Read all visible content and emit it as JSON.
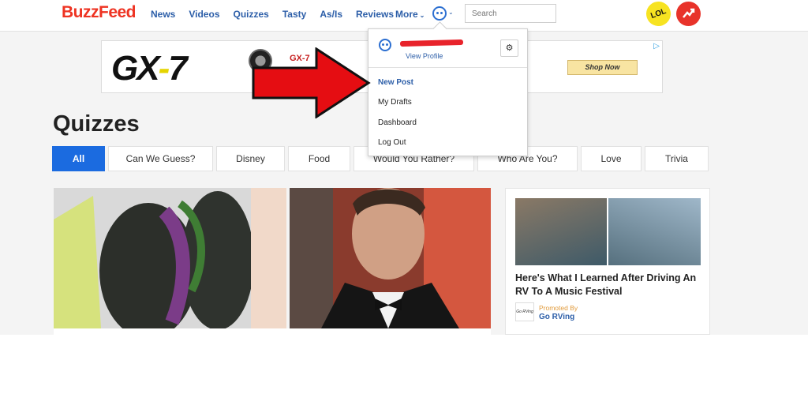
{
  "header": {
    "logo": "BuzzFeed",
    "nav": [
      "News",
      "Videos",
      "Quizzes",
      "Tasty",
      "As/Is",
      "Reviews"
    ],
    "more_label": "More",
    "search_placeholder": "Search",
    "badge_lol": "LOL"
  },
  "ad": {
    "brand_prefix": "GX",
    "brand_x": "-",
    "brand_suffix": "7",
    "small_text": "GX-7",
    "cta": "Shop Now",
    "choice_icon": "▷"
  },
  "page": {
    "title": "Quizzes",
    "tabs": [
      "All",
      "Can We Guess?",
      "Disney",
      "Food",
      "Would You Rather?",
      "Who Are You?",
      "Love",
      "Trivia"
    ],
    "active_tab": "All"
  },
  "promo": {
    "title": "Here's What I Learned After Driving An RV To A Music Festival",
    "sponsor_logo": "Go RVing",
    "promoted_by": "Promoted By",
    "sponsor": "Go RVing"
  },
  "dropdown": {
    "profile_link": "View Profile",
    "settings_icon": "⚙",
    "items": [
      "New Post",
      "My Drafts",
      "Dashboard",
      "Log Out"
    ]
  },
  "colors": {
    "brand_red": "#ee3322",
    "link_blue": "#2c5ea8",
    "active_tab_blue": "#1b6be0",
    "arrow_red": "#e50d12"
  }
}
